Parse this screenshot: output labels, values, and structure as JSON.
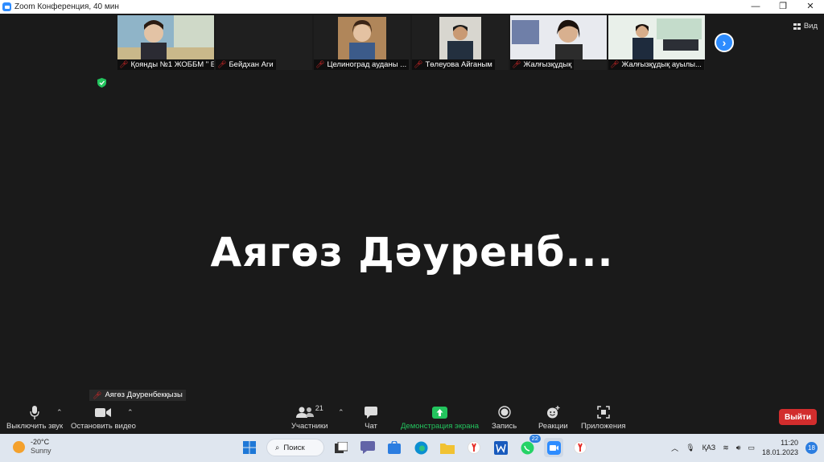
{
  "window": {
    "title": "Zoom Конференция, 40 мин",
    "minimize": "—",
    "maximize": "❐",
    "close": "✕"
  },
  "participants": [
    {
      "name": "Қоянды №1 ЖОББМ \" Б..."
    },
    {
      "name": "Бейдхан Аги"
    },
    {
      "name": "Целиноград ауданы ..."
    },
    {
      "name": "Төлеуова Айганым"
    },
    {
      "name": "Жалғызқұдық"
    },
    {
      "name": "Жалғызқұдық ауылы..."
    }
  ],
  "view_label": "Вид",
  "active_speaker": "Аягөз Дәуренб...",
  "self_name_tag": "Аягөз Дәуренбекқызы",
  "toolbar": {
    "mute": "Выключить звук",
    "stop_video": "Остановить видео",
    "participants": "Участники",
    "participants_count": "21",
    "chat": "Чат",
    "share": "Демонстрация экрана",
    "record": "Запись",
    "reactions": "Реакции",
    "apps": "Приложения",
    "leave": "Выйти"
  },
  "colors": {
    "accent": "#2D8CFF",
    "share_green": "#23c45e",
    "leave_red": "#d22d2d"
  },
  "taskbar": {
    "temp": "-20°C",
    "condition": "Sunny",
    "search": "Поиск",
    "whatsapp_badge": "22",
    "lang": "ҚАЗ",
    "time": "11:20",
    "date": "18.01.2023",
    "notifications": "18"
  }
}
